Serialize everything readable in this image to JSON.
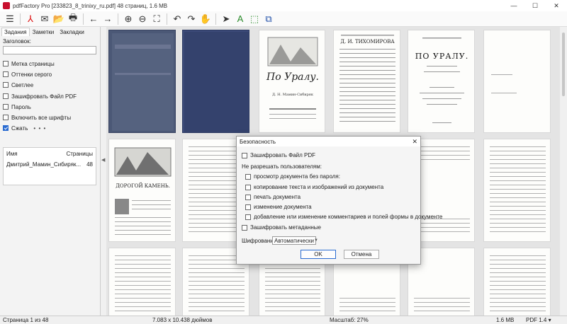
{
  "window": {
    "title": "pdfFactory Pro [233823_8_trinixy_ru.pdf] 48 страниц, 1.6 MB",
    "minimize": "—",
    "maximize": "☐",
    "close": "✕"
  },
  "toolbar": {
    "icons": [
      "menu-icon",
      "pdf-icon",
      "email-icon",
      "open-folder-icon",
      "print-icon",
      "back-arrow-icon",
      "forward-arrow-icon",
      "zoom-in-icon",
      "zoom-out-icon",
      "fit-page-icon",
      "undo-icon",
      "redo-icon",
      "hand-icon",
      "select-cursor-icon",
      "text-tool-icon",
      "area-select-icon",
      "copy-icon"
    ],
    "glyphs": {
      "menu": "☰",
      "pdf": "⅄",
      "email": "✉",
      "open": "📂",
      "print": "🖶",
      "back": "←",
      "forward": "→",
      "zoom_in": "⊕",
      "zoom_out": "⊖",
      "fit": "⛶",
      "undo": "↶",
      "redo": "↷",
      "hand": "✋",
      "select": "➤",
      "text": "A",
      "area": "⬚",
      "copy": "⧉"
    }
  },
  "left_panel": {
    "tabs": [
      "Задания",
      "Заметки",
      "Закладки"
    ],
    "heading_label": "Заголовок:",
    "options": [
      {
        "label": "Метка страницы",
        "checked": false
      },
      {
        "label": "Оттенки серого",
        "checked": false
      },
      {
        "label": "Светлее",
        "checked": false
      },
      {
        "label": "Зашифровать Файл PDF",
        "checked": false
      },
      {
        "label": "Пароль",
        "checked": false
      },
      {
        "label": "Включить все шрифты",
        "checked": false
      },
      {
        "label": "Сжать",
        "checked": true
      }
    ],
    "more": "• • •",
    "list_headers": {
      "name": "Имя",
      "pages": "Страницы"
    },
    "list_rows": [
      {
        "name": "Дмитрий_Мамин_Сибиряк...",
        "pages": "48"
      }
    ],
    "collapse_arrow": "◀"
  },
  "dialog": {
    "title": "Безопасность",
    "close": "✕",
    "encrypt_pdf": "Зашифровать Файл PDF",
    "disallow_label": "Не разрешать пользователям:",
    "permissions": [
      "просмотр документа без пароля:",
      "копирование текста и изображений из документа",
      "печать документа",
      "изменение документа",
      "добавление или изменение комментариев и полей формы в документе"
    ],
    "encrypt_metadata": "Зашифровать метаданные",
    "cipher_label": "Шифрование:",
    "cipher_value": "Автоматически",
    "ok": "OK",
    "cancel": "Отмена"
  },
  "status": {
    "page": "Страница 1 из 48",
    "size": "7.083 x 10.438 дюймов",
    "zoom": "Масштаб: 27%",
    "file_size": "1.6 MB",
    "pdf_version": "PDF 1.4 ▾"
  },
  "pages": {
    "count_visible": 18,
    "covers": [
      "По Уралу.",
      "Д. Н. Мамин-Сибиряк",
      "ДОРОГОЙ КАМЕНЬ.",
      "Д. И. ТИХОМИРОВА",
      "ПО УРАЛУ."
    ]
  }
}
